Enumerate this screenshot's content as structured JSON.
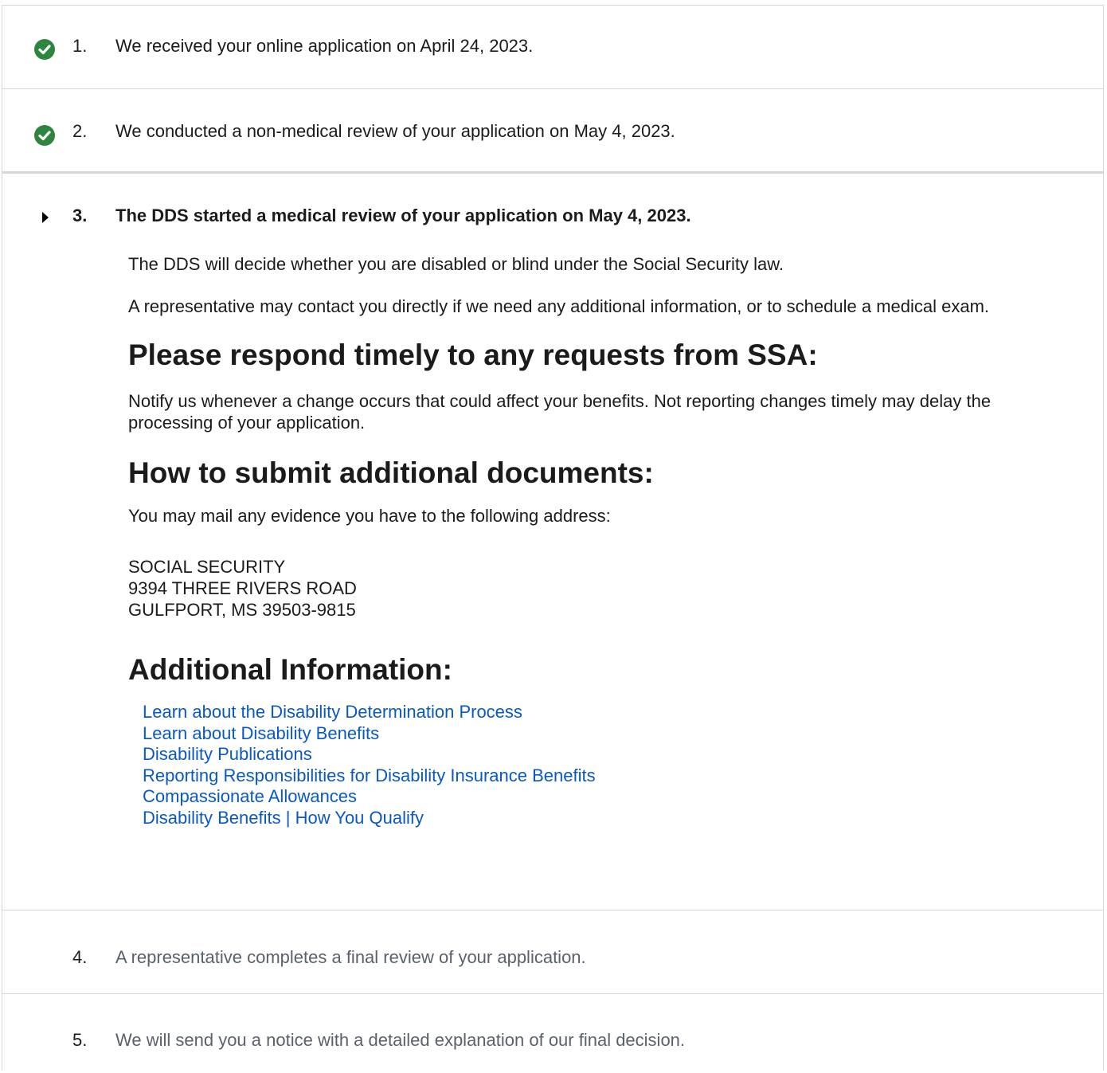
{
  "steps": [
    {
      "number": "1.",
      "text": "We received your online application on April 24, 2023.",
      "status": "complete",
      "icon": "check-circle-icon"
    },
    {
      "number": "2.",
      "text": "We conducted a non-medical review of your application on May 4, 2023.",
      "status": "complete",
      "icon": "check-circle-icon"
    },
    {
      "number": "3.",
      "text": "The DDS started a medical review of your application on May 4, 2023.",
      "status": "current",
      "icon": "caret-right-icon",
      "detail": {
        "para1": "The DDS will decide whether you are disabled or blind under the Social Security law.",
        "para2": "A representative may contact you directly if we need any additional information, or to schedule a medical exam.",
        "heading_respond": "Please respond timely to any requests from SSA:",
        "respond_text": "Notify us whenever a change occurs that could affect your benefits. Not reporting changes timely may delay the processing of your application.",
        "heading_submit": "How to submit additional documents:",
        "submit_text": "You may mail any evidence you have to the following address:",
        "address": [
          "SOCIAL SECURITY",
          "9394 THREE RIVERS ROAD",
          "GULFPORT, MS 39503-9815"
        ],
        "heading_additional": "Additional Information:",
        "links": [
          "Learn about the Disability Determination Process",
          "Learn about Disability Benefits",
          "Disability Publications",
          "Reporting Responsibilities for Disability Insurance Benefits",
          "Compassionate Allowances",
          "Disability Benefits | How You Qualify"
        ]
      }
    },
    {
      "number": "4.",
      "text": "A representative completes a final review of your application.",
      "status": "pending"
    },
    {
      "number": "5.",
      "text": "We will send you a notice with a detailed explanation of our final decision.",
      "status": "pending"
    }
  ],
  "colors": {
    "check_green": "#2e8540",
    "link_blue": "#0a59c2",
    "text_dark": "#1b1b1b",
    "text_muted": "#5b616b",
    "border": "#d6d6d6"
  }
}
